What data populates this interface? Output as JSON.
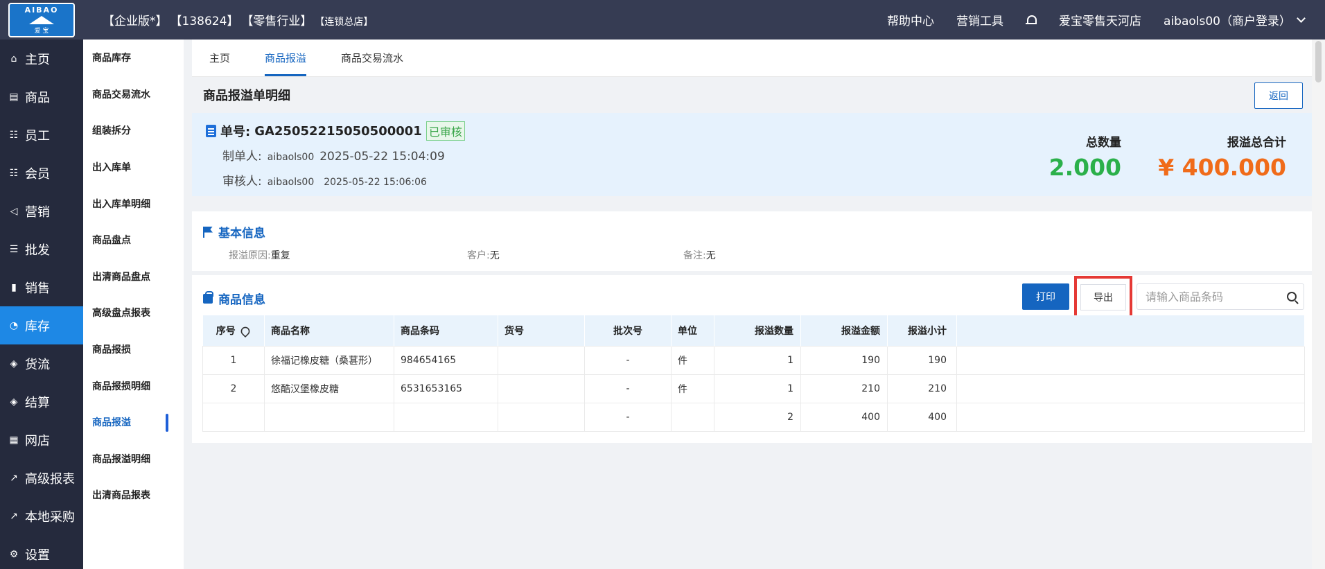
{
  "header": {
    "logo_top": "AIBAO",
    "logo_bottom": "爱 宝",
    "title_parts": [
      "【企业版*】",
      "【138624】",
      "【零售行业】"
    ],
    "title_small": "【连锁总店】",
    "help": "帮助中心",
    "marketing_tools": "营销工具",
    "store": "爱宝零售天河店",
    "user": "aibaols00（商户登录）"
  },
  "leftnav": [
    {
      "icon": "⌂",
      "label": "主页"
    },
    {
      "icon": "▤",
      "label": "商品"
    },
    {
      "icon": "☷",
      "label": "员工"
    },
    {
      "icon": "☷",
      "label": "会员"
    },
    {
      "icon": "◁",
      "label": "营销"
    },
    {
      "icon": "☰",
      "label": "批发"
    },
    {
      "icon": "▮",
      "label": "销售"
    },
    {
      "icon": "◔",
      "label": "库存"
    },
    {
      "icon": "◈",
      "label": "货流"
    },
    {
      "icon": "◈",
      "label": "结算"
    },
    {
      "icon": "▦",
      "label": "网店"
    },
    {
      "icon": "↗",
      "label": "高级报表"
    },
    {
      "icon": "↗",
      "label": "本地采购"
    },
    {
      "icon": "⚙",
      "label": "设置"
    }
  ],
  "subnav": [
    "商品库存",
    "商品交易流水",
    "组装拆分",
    "出入库单",
    "出入库单明细",
    "商品盘点",
    "出清商品盘点",
    "高级盘点报表",
    "商品报损",
    "商品报损明细",
    "商品报溢",
    "商品报溢明细",
    "出清商品报表"
  ],
  "tabs": [
    "主页",
    "商品报溢",
    "商品交易流水"
  ],
  "page": {
    "title": "商品报溢单明细",
    "back": "返回"
  },
  "order": {
    "no_label": "单号:",
    "no": "GA25052215050500001",
    "status": "已审核",
    "maker_label": "制单人:",
    "maker": "aibaols00",
    "maker_time": "2025-05-22 15:04:09",
    "auditor_label": "审核人:",
    "auditor": "aibaols00",
    "auditor_time": "2025-05-22 15:06:06",
    "qty_label": "总数量",
    "qty": "2.000",
    "total_label": "报溢总合计",
    "total": "¥ 400.000"
  },
  "basic": {
    "title": "基本信息",
    "reason_label": "报溢原因:",
    "reason": "重复",
    "customer_label": "客户:",
    "customer": "无",
    "remark_label": "备注:",
    "remark": "无"
  },
  "goods": {
    "title": "商品信息",
    "print": "打印",
    "export": "导出",
    "search_placeholder": "请输入商品条码",
    "columns": [
      "序号",
      "商品名称",
      "商品条码",
      "货号",
      "批次号",
      "单位",
      "报溢数量",
      "报溢金额",
      "报溢小计"
    ],
    "rows": [
      [
        "1",
        "徐福记橡皮糖（桑葚形）",
        "984654165",
        "",
        "-",
        "件",
        "1",
        "190",
        "190"
      ],
      [
        "2",
        "悠酷汉堡橡皮糖",
        "6531653165",
        "",
        "-",
        "件",
        "1",
        "210",
        "210"
      ],
      [
        "",
        "",
        "",
        "",
        "-",
        "",
        "2",
        "400",
        "400"
      ]
    ]
  },
  "colors": {
    "topbar": "#363c53",
    "sidebar": "#252a3d",
    "accent": "#1565c0",
    "qty_green": "#2bb04a",
    "total_orange": "#f06b19",
    "highlight_red": "#e53935"
  }
}
